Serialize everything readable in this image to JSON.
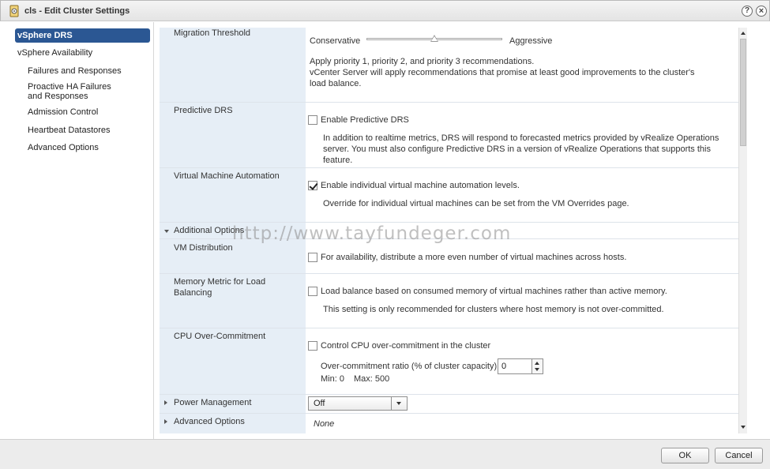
{
  "window": {
    "title": "cls - Edit Cluster Settings",
    "help_glyph": "?",
    "close_glyph": "×"
  },
  "sidebar": {
    "items": [
      {
        "label": "vSphere DRS",
        "selected": true
      },
      {
        "label": "vSphere Availability"
      },
      {
        "label": "Failures and Responses"
      },
      {
        "label": "Proactive HA Failures and Responses"
      },
      {
        "label": "Admission Control"
      },
      {
        "label": "Heartbeat Datastores"
      },
      {
        "label": "Advanced Options"
      }
    ]
  },
  "drs": {
    "migration_threshold": {
      "label": "Migration Threshold",
      "min_label": "Conservative",
      "max_label": "Aggressive",
      "level": 3,
      "levels": 5,
      "description_line1": "Apply priority 1, priority 2, and priority 3 recommendations.",
      "description_line2": "vCenter Server will apply recommendations that promise at least good improvements to the cluster's load balance."
    },
    "predictive_drs": {
      "label": "Predictive DRS",
      "checkbox_label": "Enable Predictive DRS",
      "checked": false,
      "description": "In addition to realtime metrics, DRS will respond to forecasted metrics provided by vRealize Operations server. You must also configure Predictive DRS in a version of vRealize Operations that supports this feature."
    },
    "vm_automation": {
      "label": "Virtual Machine Automation",
      "checkbox_label": "Enable individual virtual machine automation levels.",
      "checked": true,
      "description": "Override for individual virtual machines can be set from the VM Overrides page."
    },
    "additional_options": {
      "label": "Additional Options",
      "vm_distribution": {
        "label": "VM Distribution",
        "checkbox_label": "For availability, distribute a more even number of virtual machines across hosts.",
        "checked": false
      },
      "memory_metric": {
        "label": "Memory Metric for Load Balancing",
        "checkbox_label": "Load balance based on consumed memory of virtual machines rather than active memory.",
        "checked": false,
        "description": "This setting is only recommended for clusters where host memory is not over-committed."
      },
      "cpu_overcommit": {
        "label": "CPU Over-Commitment",
        "checkbox_label": "Control CPU over-commitment in the cluster",
        "checked": false,
        "ratio_label": "Over-commitment ratio (% of cluster capacity):",
        "ratio_value": "0",
        "min_text": "Min: 0",
        "max_text": "Max: 500"
      }
    },
    "power_management": {
      "label": "Power Management",
      "selected": "Off"
    },
    "advanced_options": {
      "label": "Advanced Options",
      "value": "None"
    }
  },
  "watermark": "http://www.tayfundeger.com",
  "footer": {
    "ok_label": "OK",
    "cancel_label": "Cancel"
  }
}
